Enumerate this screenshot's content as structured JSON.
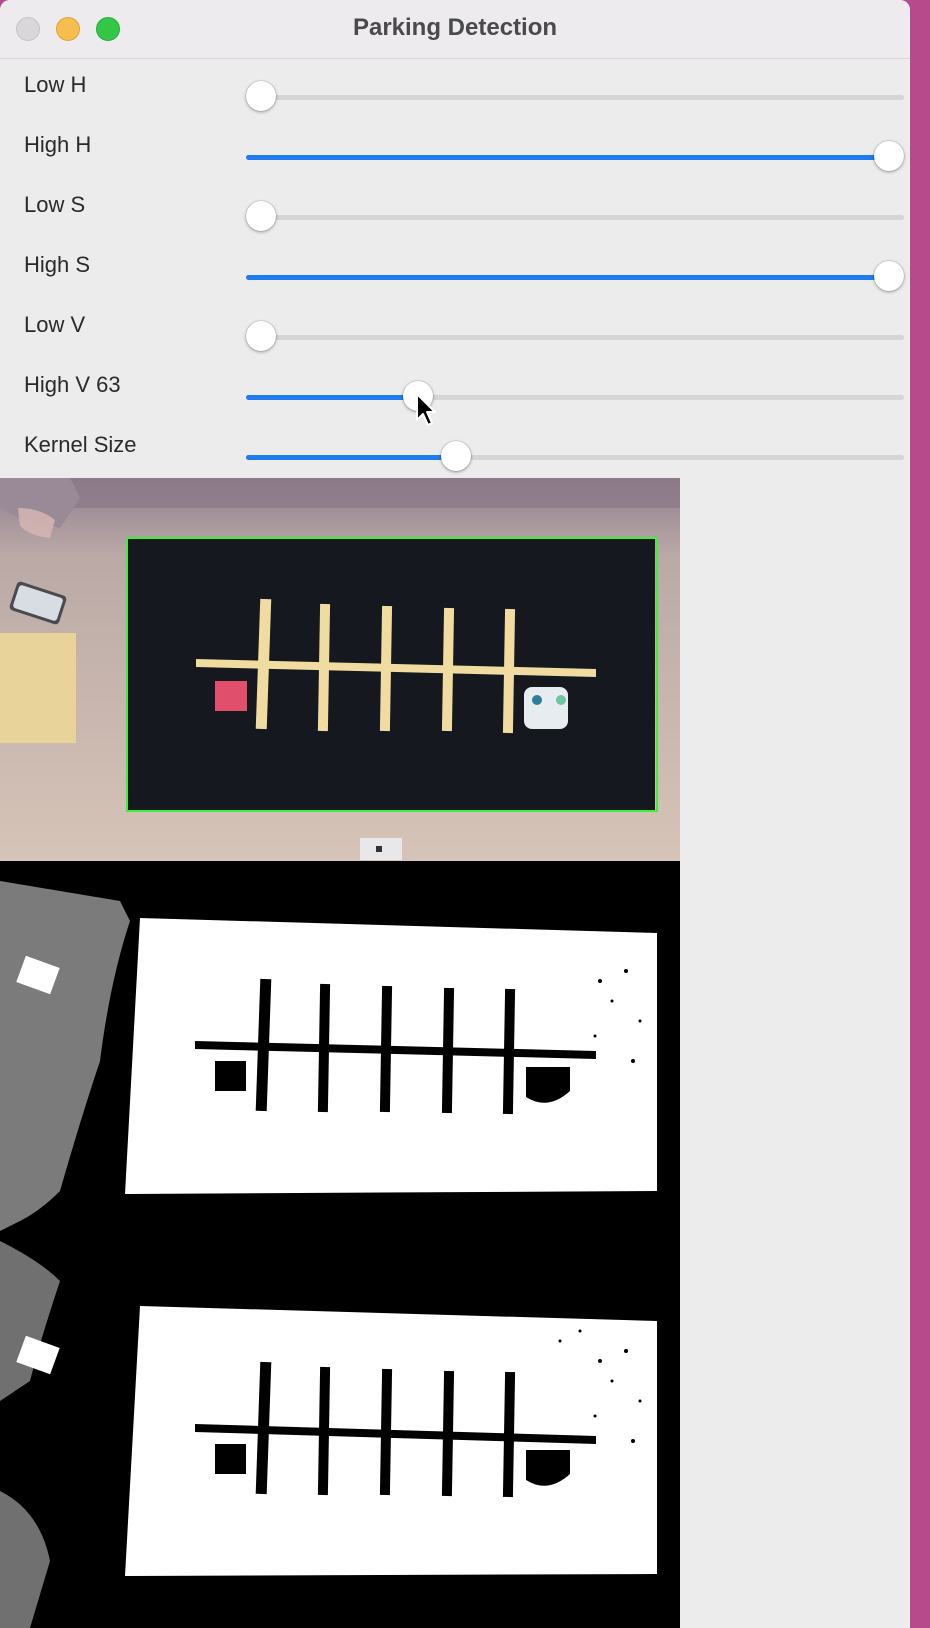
{
  "window": {
    "title": "Parking Detection",
    "buttons": [
      "close",
      "minimize",
      "zoom"
    ]
  },
  "sliders": [
    {
      "label": "Low H",
      "level": 0.0
    },
    {
      "label": "High H",
      "level": 1.0
    },
    {
      "label": "Low S",
      "level": 0.0
    },
    {
      "label": "High S",
      "level": 1.0
    },
    {
      "label": "Low V",
      "level": 0.0
    },
    {
      "label": "High V 63",
      "level": 0.25
    },
    {
      "label": "Kernel Size",
      "level": 0.31
    }
  ],
  "colors": {
    "accent": "#1e7cf0",
    "close": "#d9d7da",
    "minimize": "#f6be4f",
    "zoom": "#33c748",
    "detection_box": "#3cf03c"
  },
  "images": {
    "camera": "camera-feed-image",
    "mask": "threshold-mask-image"
  }
}
